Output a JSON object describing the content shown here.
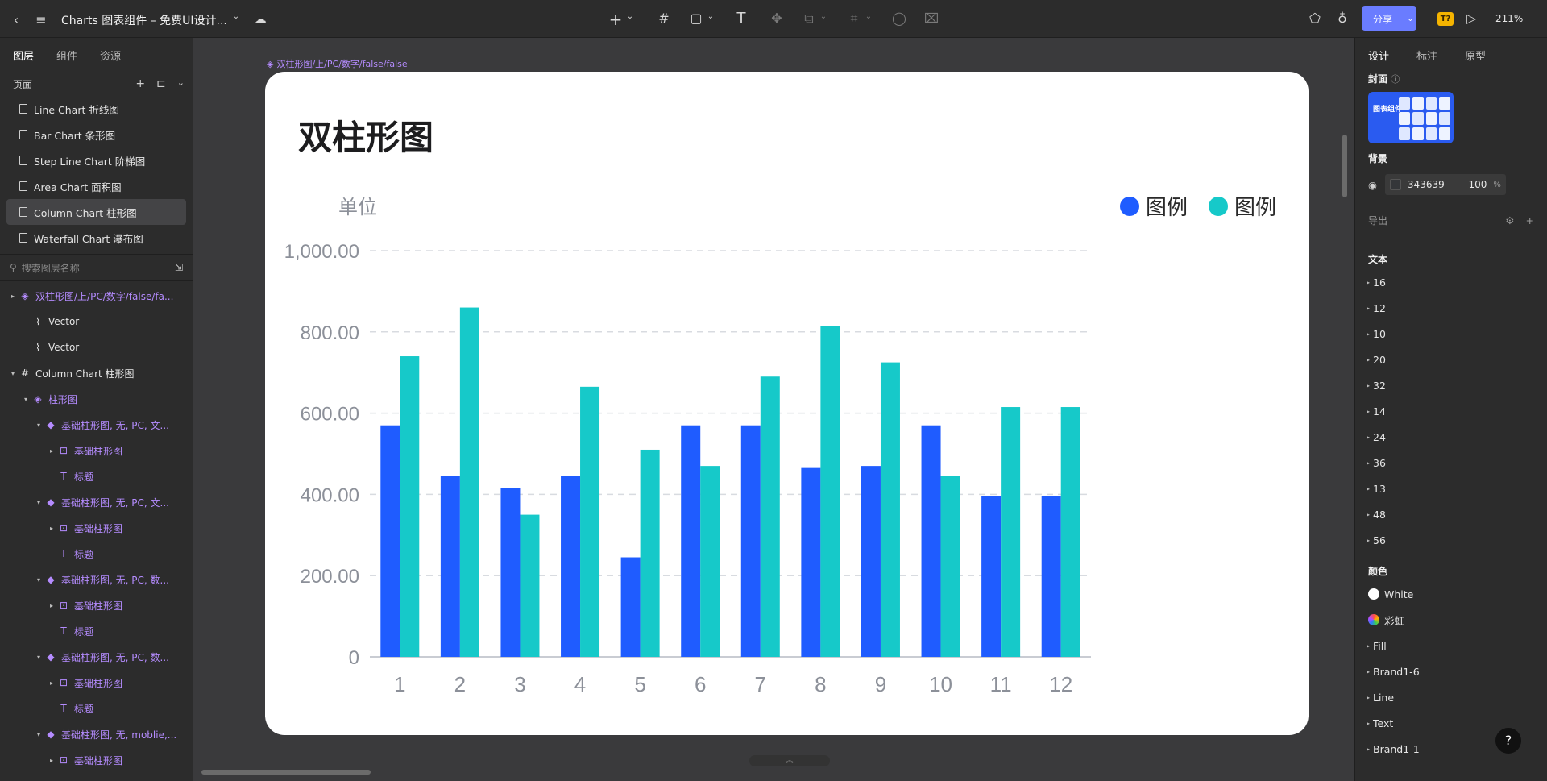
{
  "topbar": {
    "doc_title": "Charts 图表组件 – 免费UI设计...",
    "share_label": "分享",
    "zoom": "211%",
    "badge": "T?"
  },
  "left": {
    "tabs": [
      "图层",
      "组件",
      "资源"
    ],
    "pages_label": "页面",
    "pages": [
      "Line Chart 折线图",
      "Bar Chart 条形图",
      "Step Line Chart 阶梯图",
      "Area Chart 面积图",
      "Column Chart 柱形图",
      "Waterfall Chart 瀑布图"
    ],
    "selected_page_index": 4,
    "search_placeholder": "搜索图层名称",
    "layers": [
      {
        "label": "双柱形图/上/PC/数字/false/fa...",
        "indent": 0,
        "icon": "component-icon",
        "caret": "▸",
        "purple": true
      },
      {
        "label": "Vector",
        "indent": 1,
        "icon": "vector-icon",
        "caret": "",
        "purple": false
      },
      {
        "label": "Vector",
        "indent": 1,
        "icon": "vector-icon",
        "caret": "",
        "purple": false
      },
      {
        "label": "Column Chart 柱形图",
        "indent": 0,
        "icon": "frame-icon",
        "caret": "▾",
        "purple": false
      },
      {
        "label": "柱形图",
        "indent": 1,
        "icon": "component-icon",
        "caret": "▾",
        "purple": true
      },
      {
        "label": "基础柱形图, 无, PC, 文...",
        "indent": 2,
        "icon": "instance-icon",
        "caret": "▾",
        "purple": true
      },
      {
        "label": "基础柱形图",
        "indent": 3,
        "icon": "group-icon",
        "caret": "▸",
        "purple": true
      },
      {
        "label": "标题",
        "indent": 3,
        "icon": "text-icon",
        "caret": "",
        "purple": true
      },
      {
        "label": "基础柱形图, 无, PC, 文...",
        "indent": 2,
        "icon": "instance-icon",
        "caret": "▾",
        "purple": true
      },
      {
        "label": "基础柱形图",
        "indent": 3,
        "icon": "group-icon",
        "caret": "▸",
        "purple": true
      },
      {
        "label": "标题",
        "indent": 3,
        "icon": "text-icon",
        "caret": "",
        "purple": true
      },
      {
        "label": "基础柱形图, 无, PC, 数...",
        "indent": 2,
        "icon": "instance-icon",
        "caret": "▾",
        "purple": true
      },
      {
        "label": "基础柱形图",
        "indent": 3,
        "icon": "group-icon",
        "caret": "▸",
        "purple": true
      },
      {
        "label": "标题",
        "indent": 3,
        "icon": "text-icon",
        "caret": "",
        "purple": true
      },
      {
        "label": "基础柱形图, 无, PC, 数...",
        "indent": 2,
        "icon": "instance-icon",
        "caret": "▾",
        "purple": true
      },
      {
        "label": "基础柱形图",
        "indent": 3,
        "icon": "group-icon",
        "caret": "▸",
        "purple": true
      },
      {
        "label": "标题",
        "indent": 3,
        "icon": "text-icon",
        "caret": "",
        "purple": true
      },
      {
        "label": "基础柱形图, 无, moblie,...",
        "indent": 2,
        "icon": "instance-icon",
        "caret": "▾",
        "purple": true
      },
      {
        "label": "基础柱形图",
        "indent": 3,
        "icon": "group-icon",
        "caret": "▸",
        "purple": true
      }
    ]
  },
  "canvas": {
    "frame_label": "双柱形图/上/PC/数字/false/false"
  },
  "right": {
    "tabs": [
      "设计",
      "标注",
      "原型"
    ],
    "cover_label": "封面",
    "cover_thumb_text": "图表组件",
    "background_label": "背景",
    "bg_hex": "343639",
    "bg_opacity": "100",
    "bg_percent": "%",
    "export_label": "导出",
    "text_label": "文本",
    "text_sizes": [
      "16",
      "12",
      "10",
      "20",
      "32",
      "14",
      "24",
      "36",
      "13",
      "48",
      "56"
    ],
    "color_label": "颜色",
    "colors": [
      {
        "name": "White",
        "swatch": "#ffffff"
      },
      {
        "name": "彩虹",
        "swatch": "rainbow"
      }
    ],
    "color_groups": [
      "Fill",
      "Brand1-6",
      "Line",
      "Text",
      "Brand1-1"
    ],
    "help": "?"
  },
  "chart_data": {
    "type": "bar",
    "title": "双柱形图",
    "unit_label": "单位",
    "categories": [
      "1",
      "2",
      "3",
      "4",
      "5",
      "6",
      "7",
      "8",
      "9",
      "10",
      "11",
      "12"
    ],
    "series": [
      {
        "name": "图例",
        "color": "#1f5cff",
        "values": [
          570,
          445,
          415,
          445,
          245,
          570,
          570,
          465,
          470,
          570,
          395,
          395
        ]
      },
      {
        "name": "图例",
        "color": "#16c9c9",
        "values": [
          740,
          860,
          350,
          665,
          510,
          470,
          690,
          815,
          725,
          445,
          615,
          615
        ]
      }
    ],
    "yticks": [
      "0",
      "200.00",
      "400.00",
      "600.00",
      "800.00",
      "1,000.00"
    ],
    "ylim": [
      0,
      1000
    ],
    "grid": true,
    "legend_position": "top-right"
  }
}
